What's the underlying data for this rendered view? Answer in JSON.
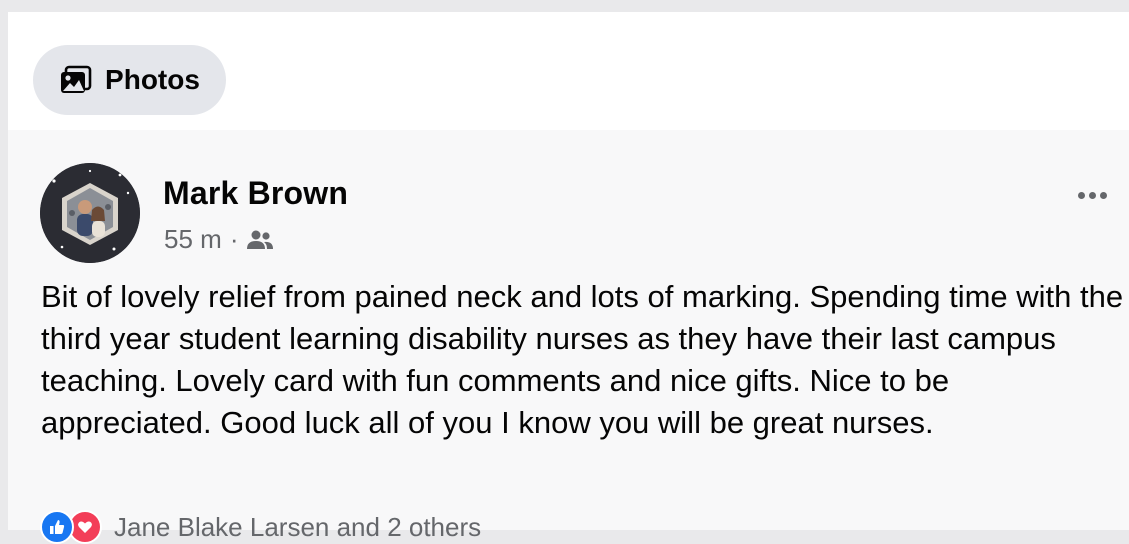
{
  "photos_chip": {
    "label": "Photos",
    "icon": "photos-icon"
  },
  "post": {
    "author": "Mark Brown",
    "time": "55 m",
    "separator": "·",
    "audience_icon": "friends-icon",
    "more_icon": "more-options-icon",
    "text": "Bit of lovely relief from pained neck and lots of marking. Spending time with the third year student learning disability nurses as they have their last campus teaching. Lovely card with fun comments and nice gifts. Nice to be appreciated. Good luck all of you I know you will be great nurses.",
    "reactions": {
      "icons": [
        "like-icon",
        "love-icon"
      ],
      "summary": "Jane Blake Larsen and 2 others"
    }
  },
  "colors": {
    "accent_blue": "#1877f2",
    "love_red": "#f33e58",
    "secondary_text": "#65676b",
    "chip_bg": "#e4e6eb"
  }
}
